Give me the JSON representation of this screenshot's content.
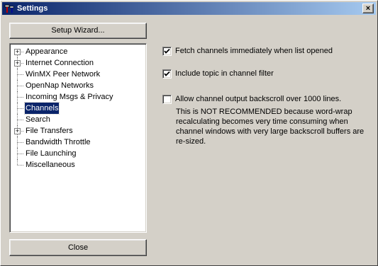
{
  "window": {
    "title": "Settings",
    "close_glyph": "×"
  },
  "buttons": {
    "setup_wizard": "Setup Wizard...",
    "close": "Close"
  },
  "tree": [
    {
      "label": "Appearance",
      "expandable": true
    },
    {
      "label": "Internet Connection",
      "expandable": true
    },
    {
      "label": "WinMX Peer Network",
      "expandable": false
    },
    {
      "label": "OpenNap Networks",
      "expandable": false
    },
    {
      "label": "Incoming Msgs & Privacy",
      "expandable": false
    },
    {
      "label": "Channels",
      "expandable": false,
      "selected": true
    },
    {
      "label": "Search",
      "expandable": false
    },
    {
      "label": "File Transfers",
      "expandable": true
    },
    {
      "label": "Bandwidth Throttle",
      "expandable": false
    },
    {
      "label": "File Launching",
      "expandable": false
    },
    {
      "label": "Miscellaneous",
      "expandable": false
    }
  ],
  "options": [
    {
      "label": "Fetch channels immediately when list opened",
      "checked": true
    },
    {
      "label": "Include topic in channel filter",
      "checked": true
    },
    {
      "label": "Allow channel output backscroll over 1000 lines.",
      "checked": false
    }
  ],
  "note": "This is NOT RECOMMENDED because word-wrap recalculating becomes very time consuming when channel windows with very large backscroll buffers are re-sized.",
  "icons": {
    "expand": "plus-box-icon",
    "check": "checkmark-icon",
    "app": "settings-app-icon"
  },
  "colors": {
    "titlebar_start": "#0a246a",
    "titlebar_end": "#a6caf0",
    "selection": "#0a246a",
    "face": "#d4d0c8"
  }
}
